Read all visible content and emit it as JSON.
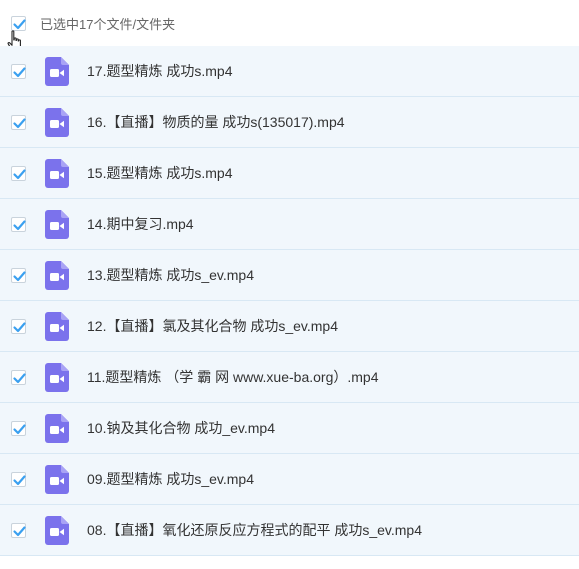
{
  "header": {
    "selection_text": "已选中17个文件/文件夹"
  },
  "colors": {
    "check": "#3aa0f0",
    "video_icon": "#7b72ec",
    "row_bg": "#f1f7fc"
  },
  "icons": {
    "checkbox": "checkmark-icon",
    "file": "video-file-icon",
    "cursor": "hand-pointer-icon"
  },
  "files": [
    {
      "name": "17.题型精炼 成功s.mp4",
      "checked": true
    },
    {
      "name": "16.【直播】物质的量 成功s(135017).mp4",
      "checked": true
    },
    {
      "name": "15.题型精炼 成功s.mp4",
      "checked": true
    },
    {
      "name": "14.期中复习.mp4",
      "checked": true
    },
    {
      "name": "13.题型精炼 成功s_ev.mp4",
      "checked": true
    },
    {
      "name": "12.【直播】氯及其化合物 成功s_ev.mp4",
      "checked": true
    },
    {
      "name": "11.题型精炼 （学 霸 网 www.xue-ba.org）.mp4",
      "checked": true
    },
    {
      "name": "10.钠及其化合物 成功_ev.mp4",
      "checked": true
    },
    {
      "name": "09.题型精炼 成功s_ev.mp4",
      "checked": true
    },
    {
      "name": "08.【直播】氧化还原反应方程式的配平 成功s_ev.mp4",
      "checked": true
    }
  ]
}
